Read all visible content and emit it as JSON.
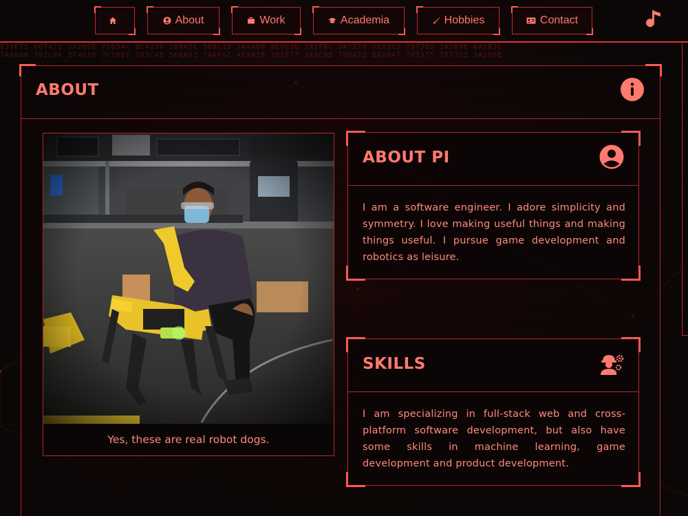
{
  "nav": {
    "items": [
      {
        "label": "",
        "icon": "home-icon"
      },
      {
        "label": "About",
        "icon": "user-circle-icon"
      },
      {
        "label": "Work",
        "icon": "briefcase-icon"
      },
      {
        "label": "Academia",
        "icon": "graduation-cap-icon"
      },
      {
        "label": "Hobbies",
        "icon": "paintbrush-icon"
      },
      {
        "label": "Contact",
        "icon": "address-card-icon"
      }
    ],
    "music_icon": "music-note-icon"
  },
  "colors": {
    "accent": "#ff7a6e",
    "border": "#b3262c",
    "bright": "#ff5a55",
    "background": "#0b0707"
  },
  "about": {
    "title": "ABOUT",
    "icon": "info-icon",
    "photo_caption": "Yes, these are real robot dogs.",
    "photo_alt": "robot-dog-photo"
  },
  "about_pi": {
    "title": "ABOUT PI",
    "icon": "user-circle-icon",
    "text": "I am a software engineer. I adore simplicity and symmetry. I love making useful things and making things useful. I pursue game development and robotics as leisure."
  },
  "skills": {
    "title": "SKILLS",
    "icon": "user-gears-icon",
    "text": "I am specializing in full-stack web and cross-platform software development, but also have some skills in machine learning, game development and product development."
  }
}
